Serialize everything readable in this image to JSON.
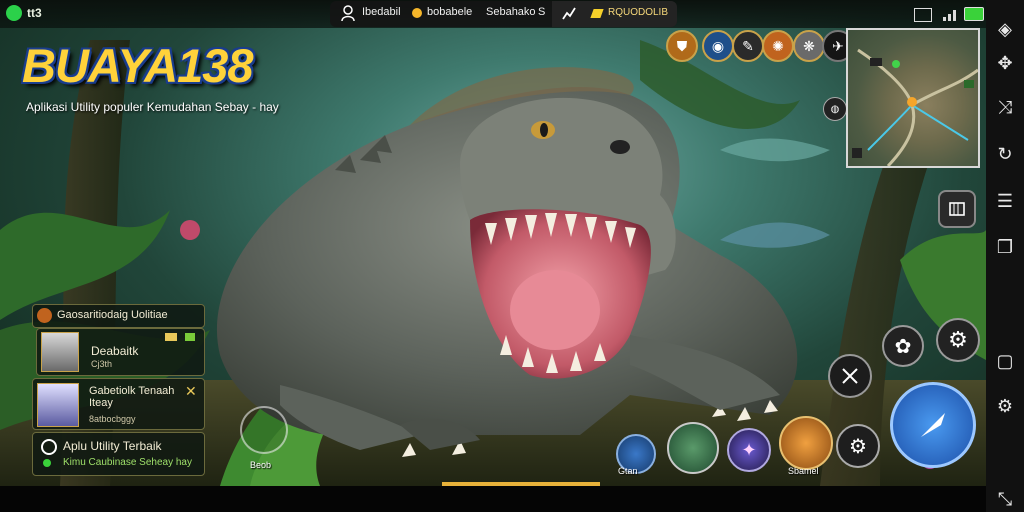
{
  "status_bar": {
    "app_badge": "tt3"
  },
  "top_center": {
    "player_name": "Ibedabil",
    "currency_label": "bobabele",
    "mode_label": "Sebahako",
    "mode_suffix": "S",
    "resource_label": "RQUODOLIB"
  },
  "logo": {
    "title": "BUAYA138",
    "subtitle": "Aplikasi Utility populer Kemudahan Sebay - hay"
  },
  "party_panel": {
    "header": "Gaosaritiodaig Uolitiae",
    "members": [
      {
        "name": "Deabaitk",
        "detail": "Cj3th"
      },
      {
        "name": "Gabetiolk Tenaah Iteay",
        "detail": "8atbocbggy"
      }
    ],
    "footer_title": "Aplu Utility Terbaik",
    "footer_sub": "Kimu Caubinase Seheay hay"
  },
  "skills": {
    "left_label": "Beob",
    "bag_label": "Gtan",
    "special_label": "Sbamel"
  },
  "colors": {
    "logo_fill": "#ffd23a",
    "logo_outline": "#1b3b8a",
    "panel_border": "#6b6a3c",
    "attack_button": "#2a6fd0",
    "progress": "#e8b23a"
  },
  "icons": {
    "sidebar": [
      "diamond-icon",
      "puzzle-icon",
      "shuffle-icon",
      "rotate-icon",
      "layers-icon",
      "copy-icon",
      "square-icon",
      "gear-icon",
      "fullscreen-icon"
    ]
  }
}
